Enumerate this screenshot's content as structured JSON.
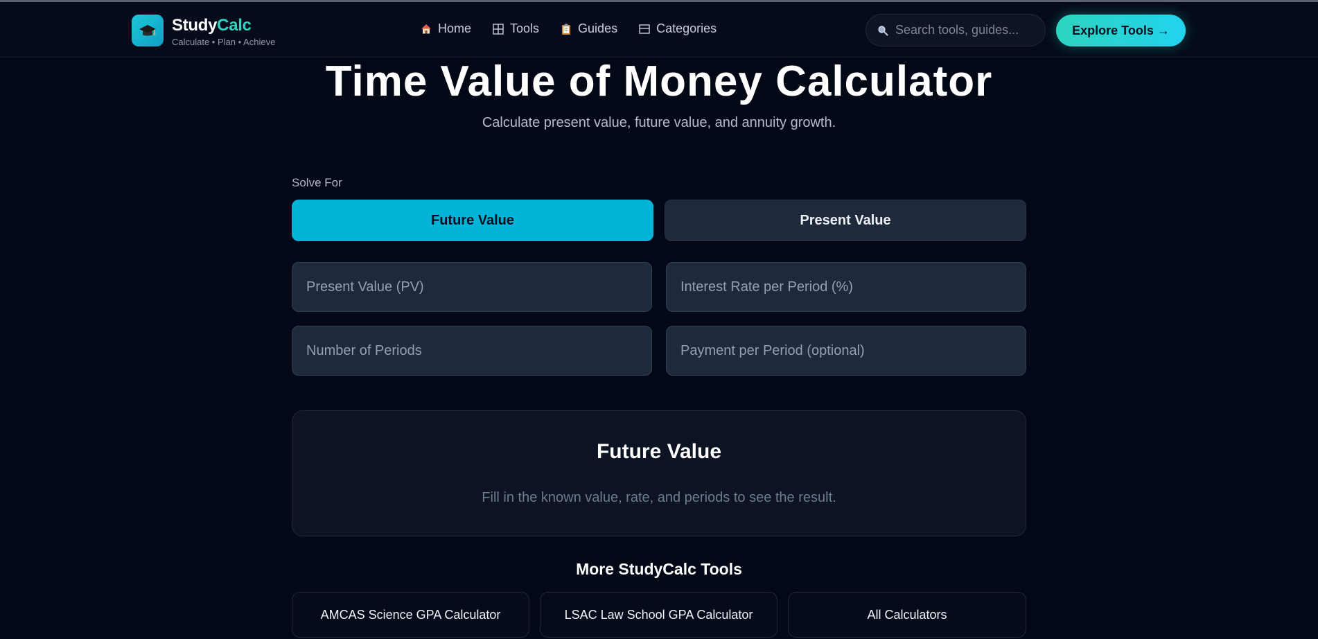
{
  "header": {
    "brand_main": "Study",
    "brand_accent": "Calc",
    "tagline": "Calculate • Plan • Achieve",
    "nav": [
      {
        "label": "Home",
        "icon": "house-icon"
      },
      {
        "label": "Tools",
        "icon": "grid-icon"
      },
      {
        "label": "Guides",
        "icon": "clipboard-icon"
      },
      {
        "label": "Categories",
        "icon": "layout-icon"
      }
    ],
    "search_placeholder": "Search tools, guides...",
    "explore_label": "Explore Tools →"
  },
  "hero": {
    "title": "Time Value of Money Calculator",
    "subtitle": "Calculate present value, future value, and annuity growth."
  },
  "form": {
    "solve_for_label": "Solve For",
    "options": [
      "Future Value",
      "Present Value"
    ],
    "selected": "Future Value",
    "fields": [
      {
        "placeholder": "Present Value (PV)",
        "value": ""
      },
      {
        "placeholder": "Interest Rate per Period (%)",
        "value": ""
      },
      {
        "placeholder": "Number of Periods",
        "value": ""
      },
      {
        "placeholder": "Payment per Period (optional)",
        "value": ""
      }
    ]
  },
  "result": {
    "title": "Future Value",
    "hint": "Fill in the known value, rate, and periods to see the result."
  },
  "more_tools": {
    "title": "More StudyCalc Tools",
    "items": [
      "AMCAS Science GPA Calculator",
      "LSAC Law School GPA Calculator",
      "All Calculators"
    ]
  },
  "colors": {
    "background": "#030816",
    "accent_cyan": "#00b4d8",
    "accent_teal": "#2dd4bf",
    "card": "#1e293b"
  }
}
